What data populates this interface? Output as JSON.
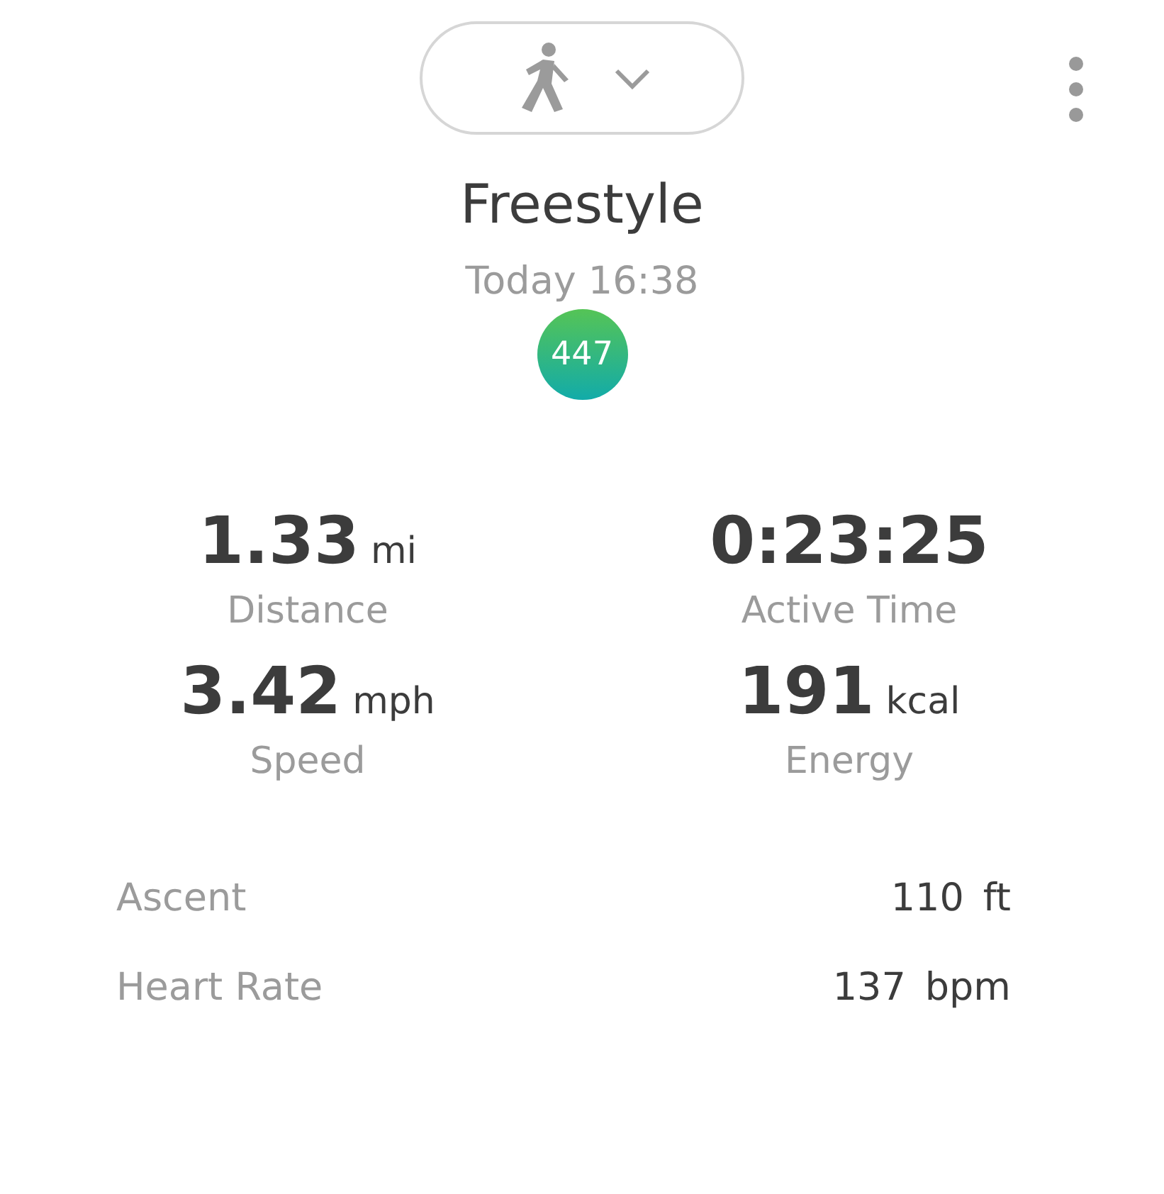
{
  "activity_selector": {
    "expanded": false
  },
  "title": "Freestyle",
  "date": "Today 16:38",
  "score_badge": "447",
  "stats": [
    {
      "value": "1.33",
      "unit": "mi",
      "label": "Distance"
    },
    {
      "value": "0:23:25",
      "label": "Active Time"
    },
    {
      "value": "3.42",
      "unit": "mph",
      "label": "Speed"
    },
    {
      "value": "191",
      "unit": "kcal",
      "label": "Energy"
    }
  ],
  "details": [
    {
      "label": "Ascent",
      "value": "110",
      "unit": "ft"
    },
    {
      "label": "Heart Rate",
      "value": "137",
      "unit": "bpm"
    }
  ]
}
